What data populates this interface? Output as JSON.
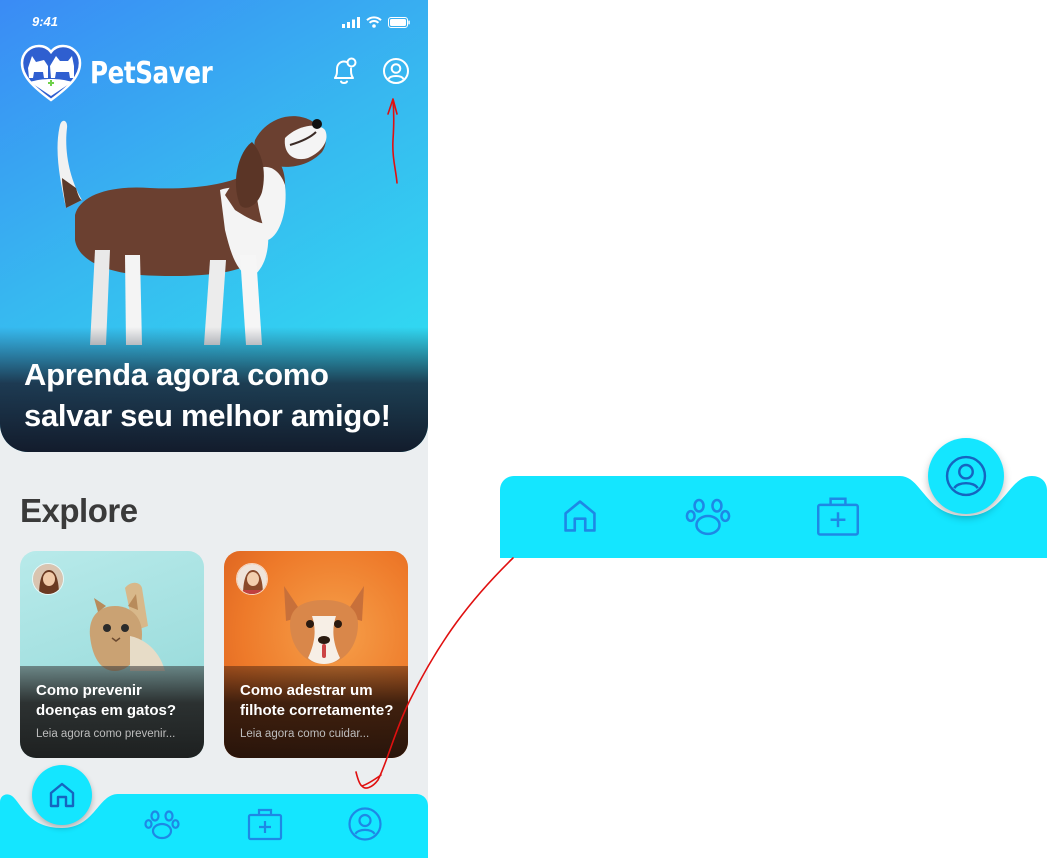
{
  "status_bar": {
    "time": "9:41"
  },
  "app": {
    "name": "PetSaver"
  },
  "hero": {
    "title": "Aprenda agora como salvar seu melhor amigo!"
  },
  "explore": {
    "title": "Explore",
    "cards": [
      {
        "title": "Como prevenir doenças em gatos?",
        "subtitle": "Leia agora como prevenir..."
      },
      {
        "title": "Como adestrar um filhote corretamente?",
        "subtitle": "Leia agora como cuidar..."
      }
    ]
  },
  "tabbar": {
    "items": [
      {
        "icon": "home-icon",
        "active": true
      },
      {
        "icon": "paw-icon",
        "active": false
      },
      {
        "icon": "first-aid-kit-icon",
        "active": false
      },
      {
        "icon": "profile-icon",
        "active": false
      }
    ],
    "bar_color": "#14e6ff",
    "icon_color": "#1e88e5"
  },
  "zoom_tabbar": {
    "items": [
      {
        "icon": "home-icon",
        "active": false
      },
      {
        "icon": "paw-icon",
        "active": false
      },
      {
        "icon": "first-aid-kit-icon",
        "active": false
      },
      {
        "icon": "profile-icon",
        "active": true
      }
    ]
  },
  "colors": {
    "accent": "#14e6ff",
    "hero_start": "#3a8bf5",
    "hero_end": "#2ee6f2",
    "annotation": "#e01010"
  }
}
